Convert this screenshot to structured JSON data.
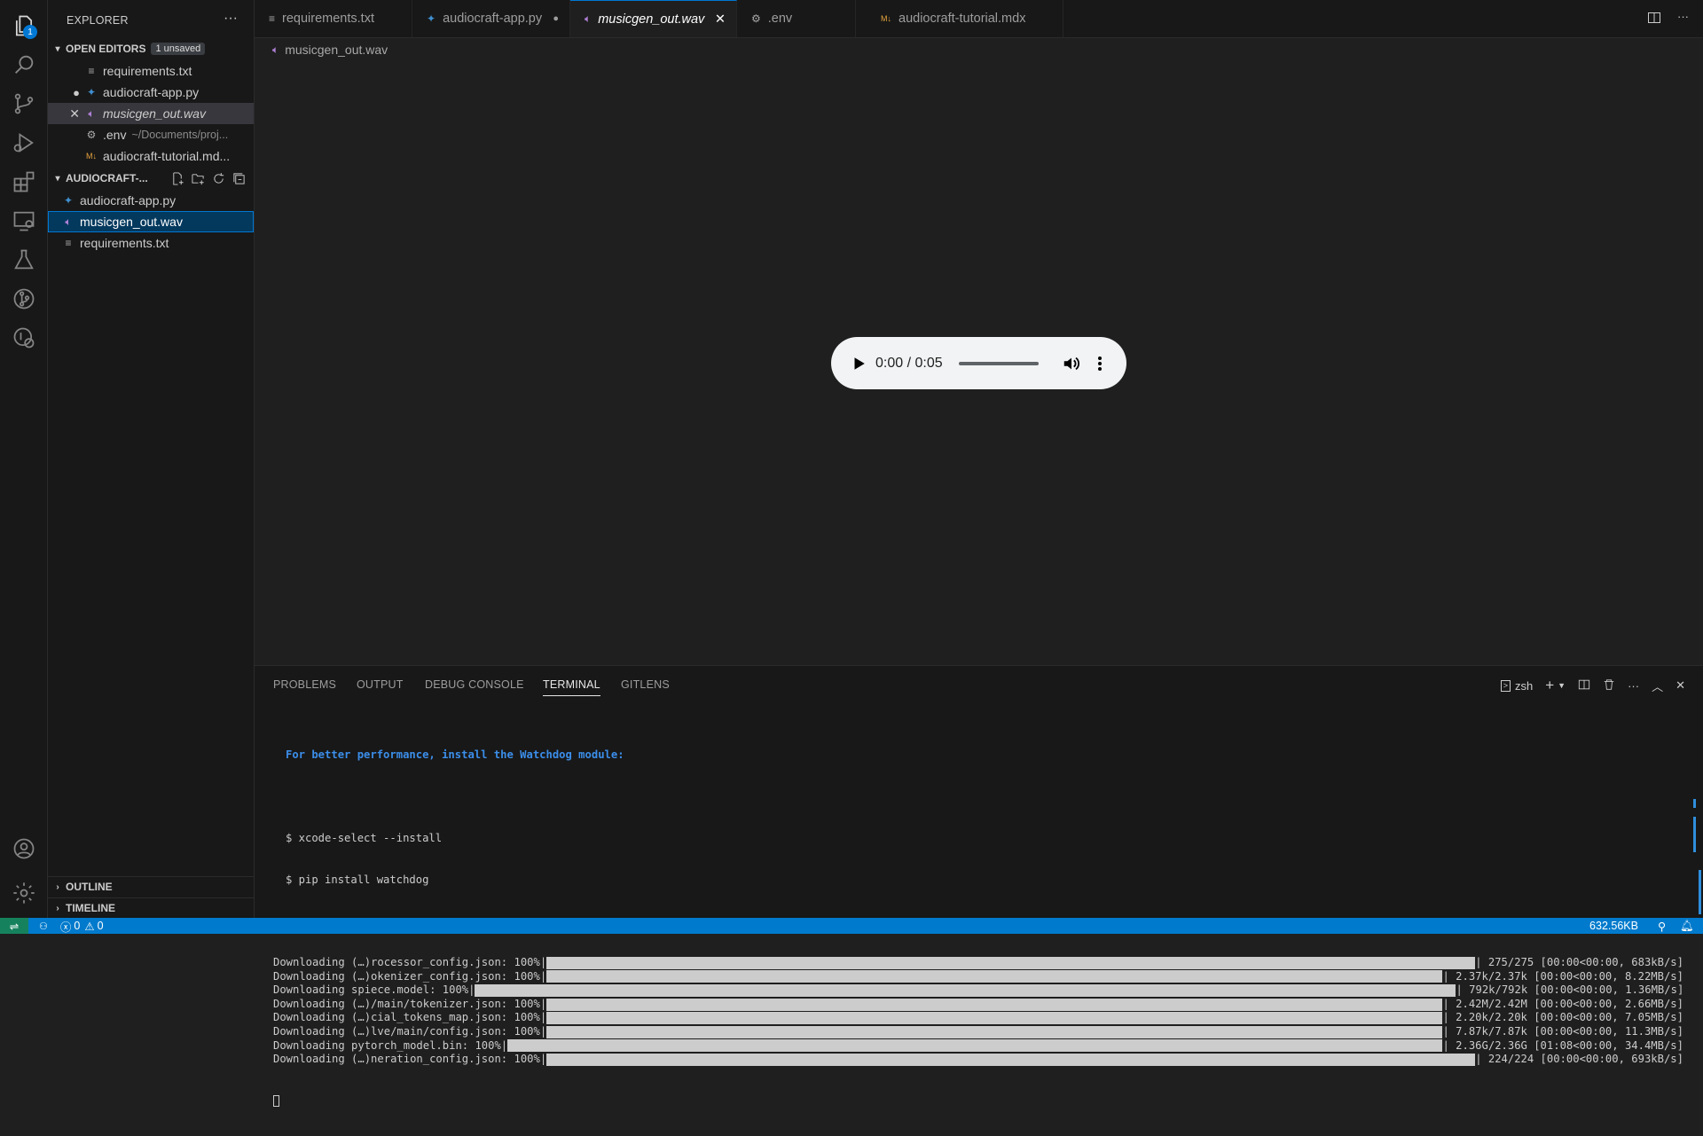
{
  "activity": {
    "explorer_badge": "1",
    "icons": [
      "files-icon",
      "search-icon",
      "source-control-icon",
      "run-debug-icon",
      "extensions-icon",
      "remote-explorer-icon",
      "testing-icon",
      "gitlens-icon",
      "gitlens-inspect-icon",
      "account-icon",
      "settings-gear-icon"
    ]
  },
  "sidebar": {
    "title": "EXPLORER",
    "open_editors": {
      "label": "OPEN EDITORS",
      "badge": "1 unsaved",
      "items": [
        {
          "name": "requirements.txt",
          "desc": ""
        },
        {
          "name": "audiocraft-app.py",
          "desc": ""
        },
        {
          "name": "musicgen_out.wav",
          "desc": ""
        },
        {
          "name": ".env",
          "desc": "~/Documents/proj..."
        },
        {
          "name": "audiocraft-tutorial.md...",
          "desc": ""
        }
      ]
    },
    "folder": {
      "label": "AUDIOCRAFT-...",
      "items": [
        {
          "name": "audiocraft-app.py"
        },
        {
          "name": "musicgen_out.wav"
        },
        {
          "name": "requirements.txt"
        }
      ]
    },
    "outline_label": "OUTLINE",
    "timeline_label": "TIMELINE"
  },
  "tabs": [
    {
      "label": "requirements.txt"
    },
    {
      "label": "audiocraft-app.py"
    },
    {
      "label": "musicgen_out.wav"
    },
    {
      "label": ".env"
    },
    {
      "label": "audiocraft-tutorial.mdx"
    }
  ],
  "breadcrumb": "musicgen_out.wav",
  "player": {
    "time": "0:00 / 0:05"
  },
  "panel": {
    "tabs": [
      "PROBLEMS",
      "OUTPUT",
      "DEBUG CONSOLE",
      "TERMINAL",
      "GITLENS"
    ],
    "shell": "zsh"
  },
  "terminal": {
    "hint": "For better performance, install the Watchdog module:",
    "cmd1": "$ xcode-select --install",
    "cmd2": "$ pip install watchdog",
    "downloads": [
      {
        "left": "Downloading (…)rocessor_config.json: 100%|",
        "right": "| 275/275 [00:00<00:00, 683kB/s]",
        "progress": 1.0
      },
      {
        "left": "Downloading (…)okenizer_config.json: 100%|",
        "right": "| 2.37k/2.37k [00:00<00:00, 8.22MB/s]",
        "progress": 1.0
      },
      {
        "left": "Downloading spiece.model: 100%|",
        "right": "| 792k/792k [00:00<00:00, 1.36MB/s]",
        "progress": 1.0
      },
      {
        "left": "Downloading (…)/main/tokenizer.json: 100%|",
        "right": "| 2.42M/2.42M [00:00<00:00, 2.66MB/s]",
        "progress": 1.0
      },
      {
        "left": "Downloading (…)cial_tokens_map.json: 100%|",
        "right": "| 2.20k/2.20k [00:00<00:00, 7.05MB/s]",
        "progress": 1.0
      },
      {
        "left": "Downloading (…)lve/main/config.json: 100%|",
        "right": "| 7.87k/7.87k [00:00<00:00, 11.3MB/s]",
        "progress": 1.0
      },
      {
        "left": "Downloading pytorch_model.bin: 100%|",
        "right": "| 2.36G/2.36G [01:08<00:00, 34.4MB/s]",
        "progress": 1.0
      },
      {
        "left": "Downloading (…)neration_config.json: 100%|",
        "right": "| 224/224 [00:00<00:00, 693kB/s]",
        "progress": 1.0
      }
    ]
  },
  "status": {
    "errors": "0",
    "warnings": "0",
    "memory": "632.56KB"
  },
  "colors": {
    "accent": "#0078d4",
    "statusbar": "#007acc",
    "wav_icon": "#b180d7",
    "python_icon": "#3572a5"
  }
}
